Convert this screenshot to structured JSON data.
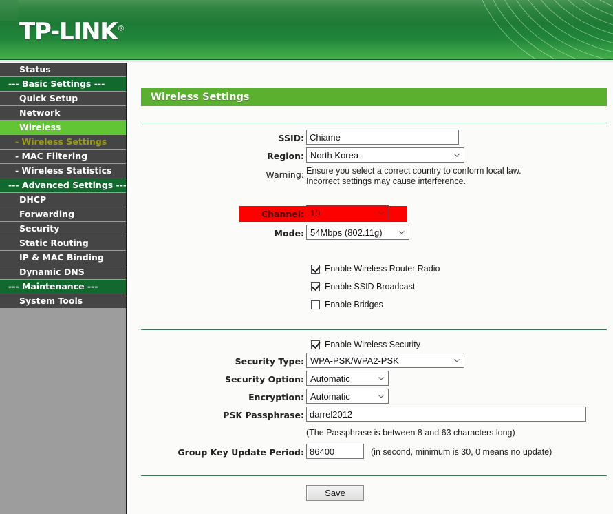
{
  "brand": {
    "name": "TP-LINK",
    "trademark": "®"
  },
  "sidebar": {
    "items": [
      {
        "label": "Status",
        "type": "item"
      },
      {
        "label": "--- Basic Settings ---",
        "type": "section"
      },
      {
        "label": "Quick Setup",
        "type": "item"
      },
      {
        "label": "Network",
        "type": "item"
      },
      {
        "label": "Wireless",
        "type": "active"
      },
      {
        "label": "- Wireless Settings",
        "type": "sub-current"
      },
      {
        "label": "- MAC Filtering",
        "type": "sub"
      },
      {
        "label": "- Wireless Statistics",
        "type": "sub"
      },
      {
        "label": "--- Advanced Settings ---",
        "type": "section"
      },
      {
        "label": "DHCP",
        "type": "item"
      },
      {
        "label": "Forwarding",
        "type": "item"
      },
      {
        "label": "Security",
        "type": "item"
      },
      {
        "label": "Static Routing",
        "type": "item"
      },
      {
        "label": "IP & MAC Binding",
        "type": "item"
      },
      {
        "label": "Dynamic DNS",
        "type": "item"
      },
      {
        "label": "--- Maintenance ---",
        "type": "section"
      },
      {
        "label": "System Tools",
        "type": "item"
      }
    ]
  },
  "page": {
    "title": "Wireless Settings"
  },
  "form": {
    "ssid": {
      "label": "SSID:",
      "value": "Chiame"
    },
    "region": {
      "label": "Region:",
      "value": "North Korea"
    },
    "warning": {
      "label": "Warning:",
      "line1": "Ensure you select a correct country to conform local law.",
      "line2": "Incorrect settings may cause interference."
    },
    "channel": {
      "label": "Channel:",
      "value": "10"
    },
    "mode": {
      "label": "Mode:",
      "value": "54Mbps (802.11g)"
    },
    "enable_radio": {
      "label": "Enable Wireless Router Radio",
      "checked": true
    },
    "enable_ssid_broadcast": {
      "label": "Enable SSID Broadcast",
      "checked": true
    },
    "enable_bridges": {
      "label": "Enable Bridges",
      "checked": false
    }
  },
  "security": {
    "enable": {
      "label": "Enable Wireless Security",
      "checked": true
    },
    "type": {
      "label": "Security Type:",
      "value": "WPA-PSK/WPA2-PSK"
    },
    "option": {
      "label": "Security Option:",
      "value": "Automatic"
    },
    "encryption": {
      "label": "Encryption:",
      "value": "Automatic"
    },
    "passphrase": {
      "label": "PSK Passphrase:",
      "value": "darrel2012"
    },
    "passphrase_hint": "(The Passphrase is between 8 and 63 characters long)",
    "group_key": {
      "label": "Group Key Update Period:",
      "value": "86400"
    },
    "group_key_hint": "(in second, minimum is 30, 0 means no update)"
  },
  "actions": {
    "save": "Save"
  },
  "colors": {
    "header_green": "#1d7a35",
    "title_green": "#5cb030",
    "active_green": "#62c634",
    "section_green": "#12692e",
    "highlight_red": "#fd0000",
    "sub_current": "#9a9a16"
  }
}
